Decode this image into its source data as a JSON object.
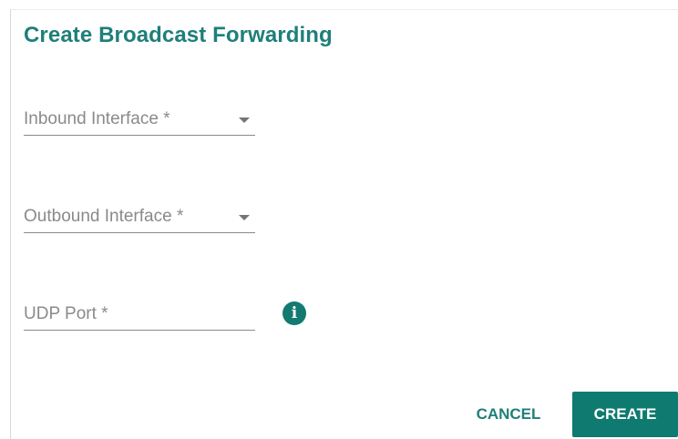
{
  "dialog": {
    "title": "Create Broadcast Forwarding"
  },
  "fields": {
    "inbound": {
      "label": "Inbound Interface *",
      "type": "select",
      "value": ""
    },
    "outbound": {
      "label": "Outbound Interface *",
      "type": "select",
      "value": ""
    },
    "udp_port": {
      "label": "UDP Port *",
      "type": "text",
      "value": ""
    }
  },
  "info_icon": {
    "glyph": "i",
    "icon": "info-icon"
  },
  "actions": {
    "cancel_label": "CANCEL",
    "create_label": "CREATE"
  },
  "colors": {
    "accent": "#1e7f7a",
    "button_fill": "#0e7a70",
    "label_gray": "#8a8a8a"
  }
}
